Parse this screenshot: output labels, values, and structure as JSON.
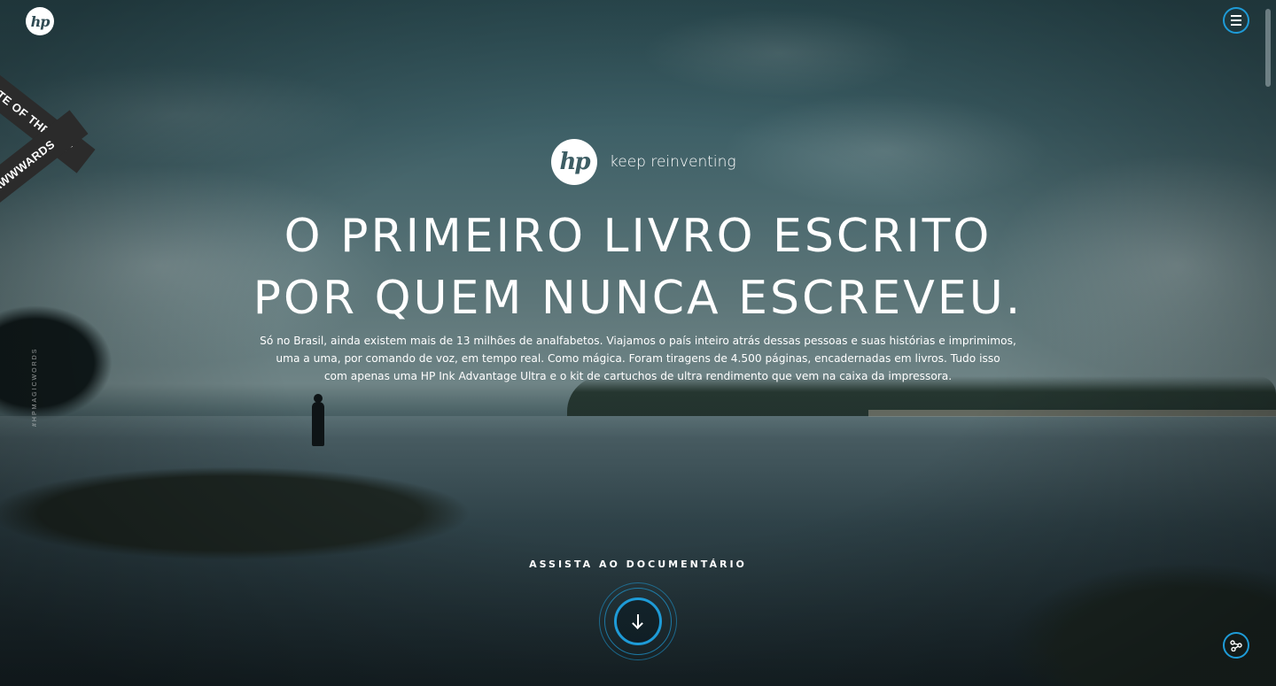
{
  "header": {
    "logo_text": "hp",
    "menu_icon": "hamburger-menu-icon"
  },
  "badge": {
    "line1": "SITE OF THE DAY",
    "line2": "AWWWARDS"
  },
  "side_tag": "#HPMAGICWORDS",
  "brand": {
    "logo_text": "hp",
    "tagline": "keep reinventing"
  },
  "hero": {
    "headline_line1": "O PRIMEIRO LIVRO ESCRITO",
    "headline_line2": "POR QUEM NUNCA ESCREVEU.",
    "intro_line1": "Só no Brasil, ainda existem mais de 13 milhões de analfabetos. Viajamos o país inteiro atrás dessas pessoas e suas histórias e imprimimos,",
    "intro_line2": "uma a uma, por comando de voz, em tempo real. Como mágica. Foram tiragens de 4.500 páginas, encadernadas em livros. Tudo isso",
    "intro_line3": "com apenas uma HP Ink Advantage Ultra e o kit de cartuchos de ultra rendimento que vem na caixa da impressora."
  },
  "cta": {
    "label": "ASSISTA AO DOCUMENTÁRIO",
    "icon": "arrow-down-icon"
  },
  "share": {
    "icon": "share-icon"
  },
  "colors": {
    "accent": "#1e9bd7",
    "text": "#ffffff"
  }
}
